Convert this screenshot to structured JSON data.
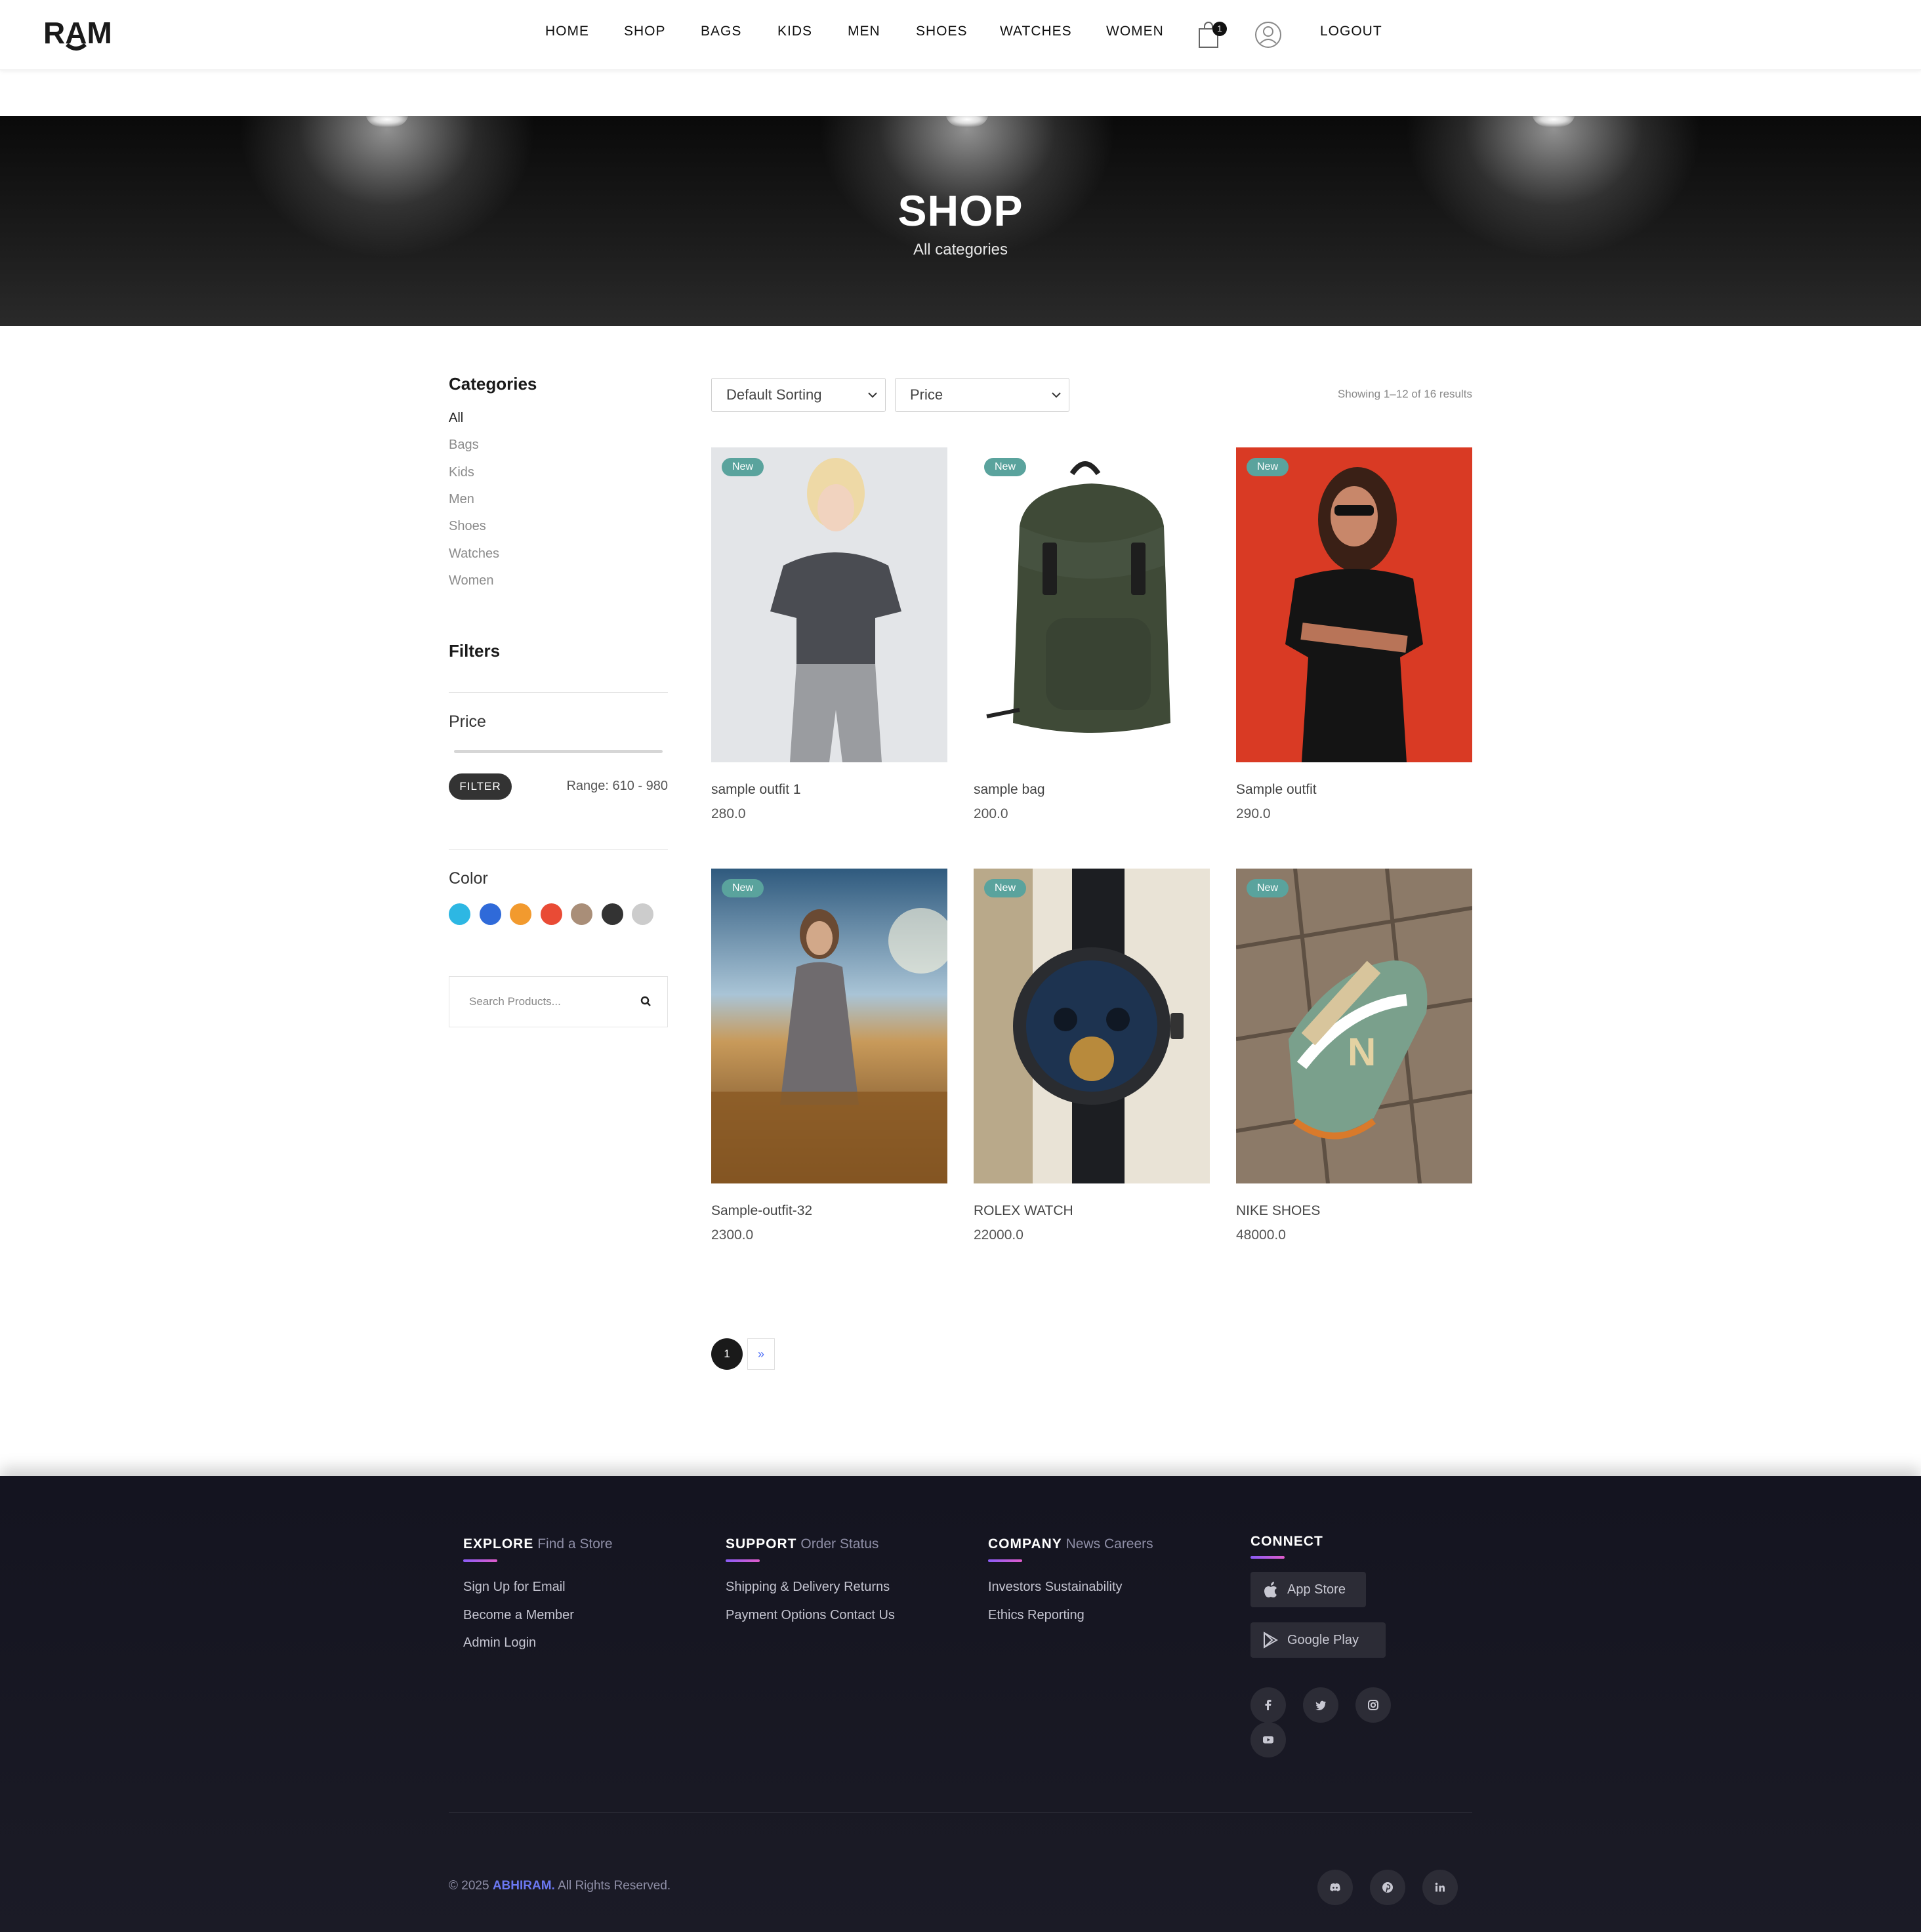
{
  "header": {
    "logo_text": "RAM",
    "nav": [
      "HOME",
      "SHOP",
      "BAGS",
      "KIDS",
      "MEN",
      "SHOES",
      "WATCHES",
      "WOMEN"
    ],
    "cart_count": "1",
    "logout_label": "LOGOUT"
  },
  "hero": {
    "title": "SHOP",
    "subtitle": "All categories"
  },
  "sidebar": {
    "categories_title": "Categories",
    "categories": [
      "All",
      "Bags",
      "Kids",
      "Men",
      "Shoes",
      "Watches",
      "Women"
    ],
    "active_category": "All",
    "filters_title": "Filters",
    "price_title": "Price",
    "filter_button": "FILTER",
    "range_label": "Range: 610 - 980",
    "color_title": "Color",
    "colors": [
      "#2db7e3",
      "#2f6ad9",
      "#f29a2e",
      "#e94b35",
      "#a98e78",
      "#333333",
      "#cccccc"
    ],
    "search_placeholder": "Search Products..."
  },
  "toolbar": {
    "sort_value": "Default Sorting",
    "price_value": "Price",
    "results_text": "Showing 1–12 of 16 results"
  },
  "products": [
    {
      "badge": "New",
      "name": "sample outfit 1",
      "price": "280.0",
      "image": "woman-grey-tshirt"
    },
    {
      "badge": "New",
      "name": "sample bag",
      "price": "200.0",
      "image": "green-backpack"
    },
    {
      "badge": "New",
      "name": "Sample outfit",
      "price": "290.0",
      "image": "woman-black-dress-red-background"
    },
    {
      "badge": "New",
      "name": "Sample-outfit-32",
      "price": "2300.0",
      "image": "woman-floral-dress-field"
    },
    {
      "badge": "New",
      "name": "ROLEX WATCH",
      "price": "22000.0",
      "image": "luxury-watch"
    },
    {
      "badge": "New",
      "name": "NIKE SHOES",
      "price": "48000.0",
      "image": "sneakers-on-pavement"
    }
  ],
  "pagination": {
    "current": "1",
    "next": "»"
  },
  "footer": {
    "columns": [
      {
        "title": "EXPLORE",
        "title_rest": "Find a Store",
        "links": [
          "Sign Up for Email",
          "Become a Member",
          "Admin Login"
        ]
      },
      {
        "title": "SUPPORT",
        "title_rest": "Order Status",
        "links": [
          "Shipping & Delivery Returns",
          "Payment Options Contact Us"
        ]
      },
      {
        "title": "COMPANY",
        "title_rest": "News Careers",
        "links": [
          "Investors Sustainability",
          "Ethics Reporting"
        ]
      }
    ],
    "connect_title": "CONNECT",
    "app_store": "App Store",
    "google_play": "Google Play",
    "social": [
      "facebook-icon",
      "twitter-icon",
      "instagram-icon",
      "youtube-icon"
    ],
    "bottom_social": [
      "discord-icon",
      "pinterest-icon",
      "linkedin-icon"
    ],
    "copyright_prefix": "© 2025",
    "copyright_brand": "ABHIRAM.",
    "copyright_suffix": "All Rights Reserved."
  }
}
